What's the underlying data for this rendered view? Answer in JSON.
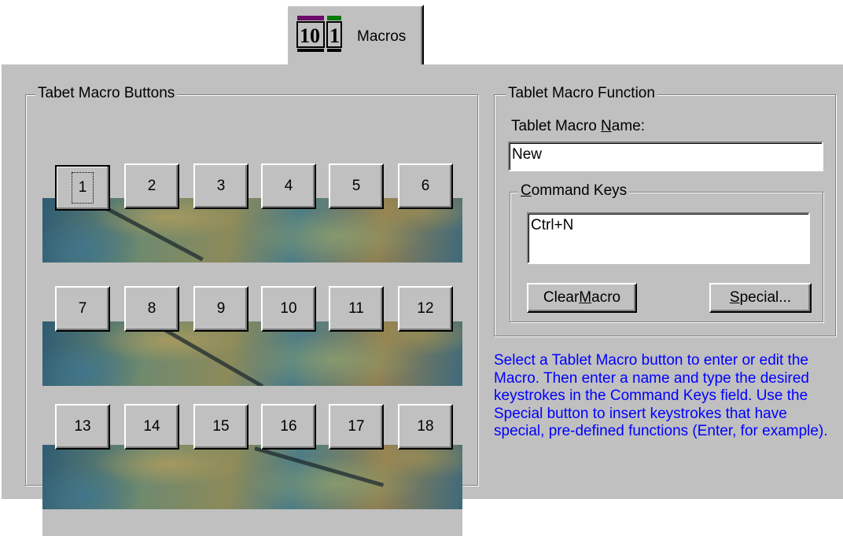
{
  "tab": {
    "label": "Macros",
    "icon": "macro-tab-icon"
  },
  "macro_group": {
    "title": "Tabet Macro Buttons",
    "rows": [
      [
        "1",
        "2",
        "3",
        "4",
        "5",
        "6"
      ],
      [
        "7",
        "8",
        "9",
        "10",
        "11",
        "12"
      ],
      [
        "13",
        "14",
        "15",
        "16",
        "17",
        "18"
      ]
    ],
    "focused_button": "1"
  },
  "function_group": {
    "title": "Tablet Macro Function",
    "name_label_pre": "Tablet Macro ",
    "name_label_key": "N",
    "name_label_post": "ame:",
    "name_value": "New",
    "command_keys": {
      "title_key": "C",
      "title_rest": "ommand Keys",
      "value": "Ctrl+N"
    },
    "clear_pre": "Clear ",
    "clear_key": "M",
    "clear_post": "acro",
    "special_key": "S",
    "special_post": "pecial..."
  },
  "help_text": "Select a Tablet Macro button to enter or edit the Macro. Then enter a name and type the desired keystrokes in the Command Keys field. Use the Special button to insert keystrokes that have special, pre-defined functions (Enter, for example).",
  "colors": {
    "face": "#c0c0c0",
    "help_text": "#0000ff"
  }
}
